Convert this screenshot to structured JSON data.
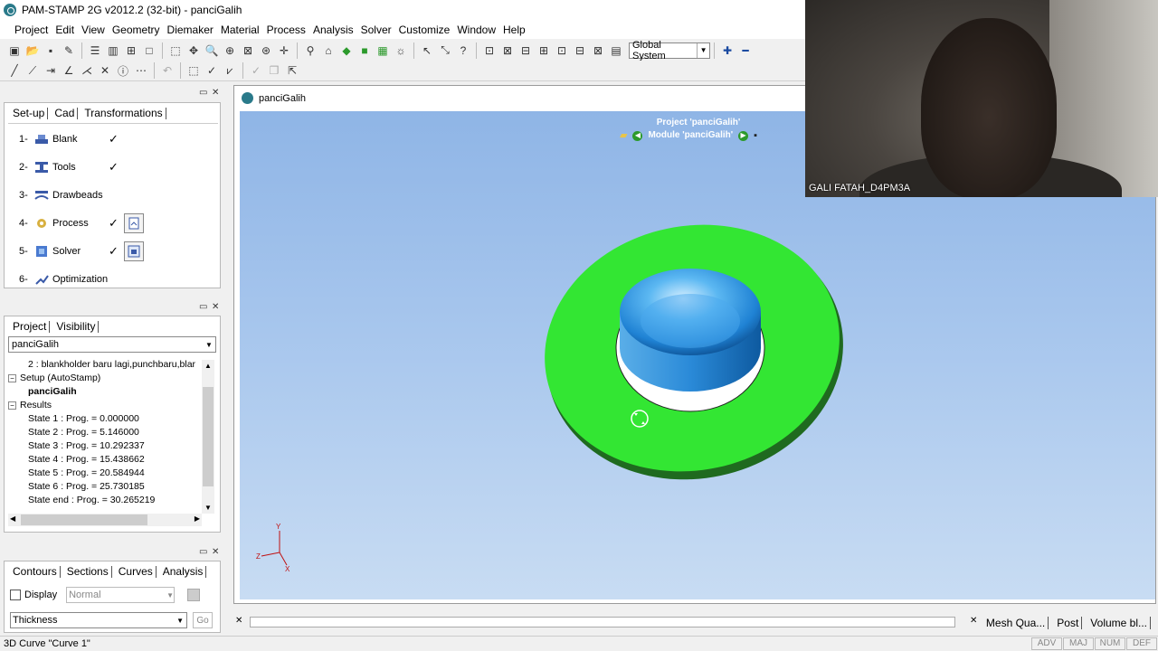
{
  "window": {
    "title": "PAM-STAMP 2G v2012.2 (32-bit) - panciGalih"
  },
  "menu": [
    "Project",
    "Edit",
    "View",
    "Geometry",
    "Diemaker",
    "Material",
    "Process",
    "Analysis",
    "Solver",
    "Customize",
    "Window",
    "Help"
  ],
  "toolbar": {
    "coordinate_system": "Global System"
  },
  "setup_panel": {
    "tabs": [
      "Set-up",
      "Cad",
      "Transformations"
    ],
    "steps": [
      {
        "num": "1-",
        "label": "Blank",
        "done": "✓"
      },
      {
        "num": "2-",
        "label": "Tools",
        "done": "✓"
      },
      {
        "num": "3-",
        "label": "Drawbeads",
        "done": ""
      },
      {
        "num": "4-",
        "label": "Process",
        "done": "✓"
      },
      {
        "num": "5-",
        "label": "Solver",
        "done": "✓"
      },
      {
        "num": "6-",
        "label": "Optimization",
        "done": ""
      }
    ]
  },
  "project_panel": {
    "tabs": [
      "Project",
      "Visibility"
    ],
    "selected": "panciGalih",
    "tree": [
      {
        "text": "2 : blankholder baru lagi,punchbaru,blar",
        "indent": 22,
        "bold": false,
        "expander": ""
      },
      {
        "text": "Setup (AutoStamp)",
        "indent": 0,
        "bold": false,
        "expander": "−"
      },
      {
        "text": "panciGalih",
        "indent": 22,
        "bold": true,
        "expander": ""
      },
      {
        "text": "Results",
        "indent": 0,
        "bold": false,
        "expander": "−"
      },
      {
        "text": "State 1 : Prog. = 0.000000",
        "indent": 22,
        "bold": false,
        "expander": ""
      },
      {
        "text": "State 2 : Prog. = 5.146000",
        "indent": 22,
        "bold": false,
        "expander": ""
      },
      {
        "text": "State 3 : Prog. = 10.292337",
        "indent": 22,
        "bold": false,
        "expander": ""
      },
      {
        "text": "State 4 : Prog. = 15.438662",
        "indent": 22,
        "bold": false,
        "expander": ""
      },
      {
        "text": "State 5 : Prog. = 20.584944",
        "indent": 22,
        "bold": false,
        "expander": ""
      },
      {
        "text": "State 6 : Prog. = 25.730185",
        "indent": 22,
        "bold": false,
        "expander": ""
      },
      {
        "text": "State end : Prog. = 30.265219",
        "indent": 22,
        "bold": false,
        "expander": ""
      }
    ]
  },
  "contours_panel": {
    "tabs": [
      "Contours",
      "Sections",
      "Curves",
      "Analysis"
    ],
    "display_label": "Display",
    "display_mode": "Normal",
    "variable": "Thickness",
    "go_label": "Go"
  },
  "viewer": {
    "title": "panciGalih",
    "project_label": "Project 'panciGalih'",
    "module_label": "Module 'panciGalih'",
    "axis_labels": {
      "x": "X",
      "y": "Y",
      "z": "Z"
    },
    "colors": {
      "blank": "#33e633",
      "punch": "#2f9ee8",
      "background": "#a7c6ed"
    }
  },
  "bottom_tabs": [
    "Mesh Qua...",
    "Post",
    "Volume bl..."
  ],
  "status": {
    "text": "3D Curve \"Curve 1\"",
    "indicators": [
      "ADV",
      "MAJ",
      "NUM",
      "DEF"
    ]
  },
  "webcam": {
    "name": "GALI FATAH_D4PM3A"
  }
}
